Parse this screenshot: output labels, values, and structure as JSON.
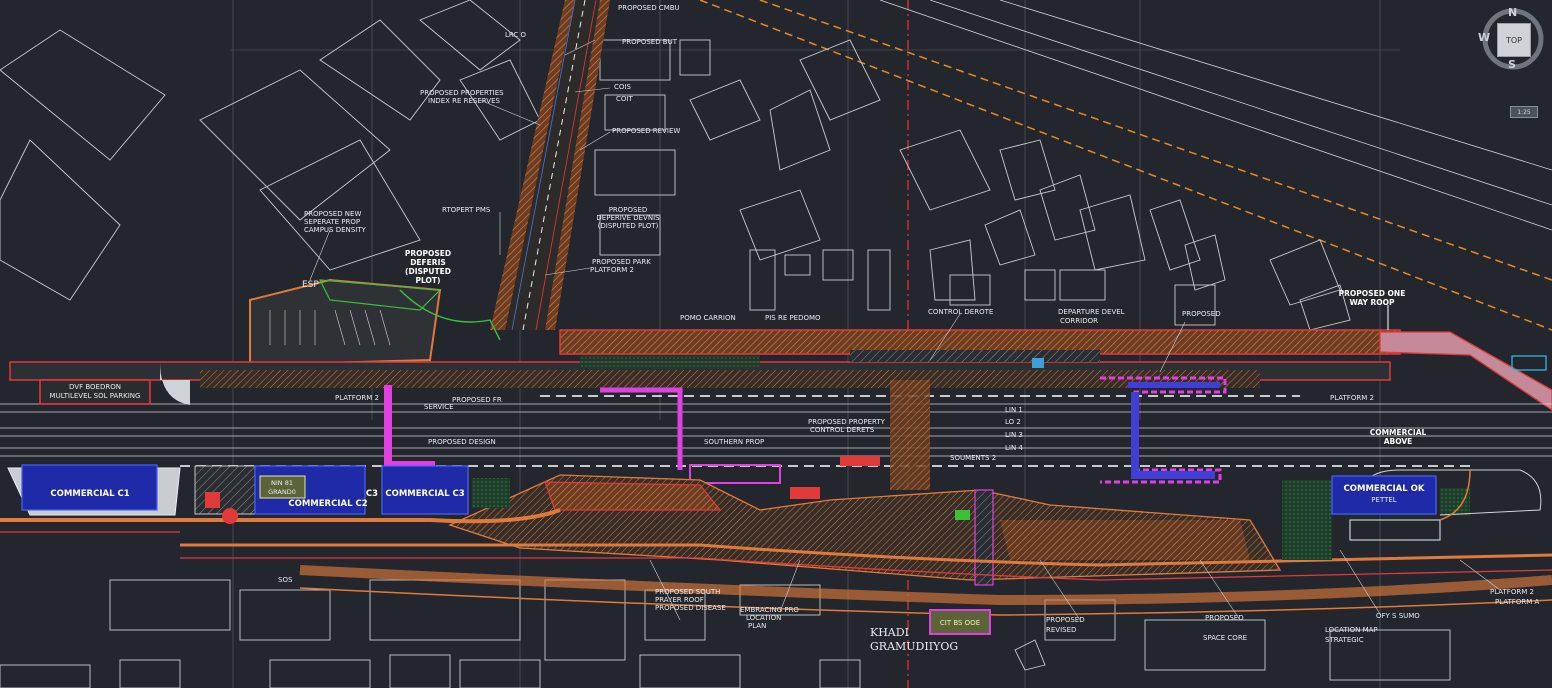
{
  "viewcube": {
    "top_label": "TOP",
    "north": "N",
    "west": "W",
    "south": "S",
    "scale_label": "1:25"
  },
  "labels": {
    "dvf_parking_1": "DVF BOEDRON",
    "dvf_parking_2": "MULTILEVEL SOL PARKING",
    "commercial_c1": "COMMERCIAL C1",
    "commercial_c2": "COMMERCIAL C2",
    "commercial_c3": "COMMERCIAL C3",
    "commercial_ok": "COMMERCIAL OK",
    "commercial_ok_sub": "PETTEL",
    "c3_label": "C3",
    "nin_grand_1": "NIN 81",
    "nin_grand_2": "GRAND0",
    "commercial_above_1": "COMMERCIAL",
    "commercial_above_2": "ABOVE",
    "proposed_fob_1": "PROPOSED ONE",
    "proposed_fob_2": "WAY ROOP",
    "platform_1": "PLATFORM 2",
    "platform_2": "PLATFORM 2",
    "proposed_disputed_1": "PROPOSED",
    "proposed_disputed_2": "DEFERIS",
    "proposed_disputed_3": "(DISPUTED",
    "proposed_disputed_4": "PLOT)",
    "disputed_plot_1": "PROPOSED",
    "disputed_plot_2": "DEPERIVE DEVNIS",
    "disputed_plot_3": "(DISPUTED PLOT)",
    "esp": "ESP",
    "sos": "SOS",
    "cit_badge": "CIT BS OOE",
    "khadi_1": "KHADI",
    "khadi_2": "GRAMUDIIYOG",
    "city_sewage": "OFY S SUMO",
    "road_a": "LRC O",
    "note_1": "PROPOSED PROPERTIES",
    "note_2": "INDEX RE RESERVES",
    "note_3": "COIS",
    "note_4": "COIT",
    "note_5": "PROPOSED REVIEW",
    "note_6": "PROPOSED CMBU",
    "note_7": "PROPOSED BUT",
    "note_8": "RTOPERT PMS",
    "note_9": "PROPOSED NEW",
    "note_10": "SEPERATE PROP",
    "note_11": "CAMPUS DENSITY",
    "note_12": "PROPOSED PARK",
    "note_13": "PLATFORM 2",
    "note_14": "POMO CARRION",
    "note_15": "PIS RE PEDOMO",
    "note_16": "CONTROL DEROTE",
    "note_17": "LIN 1",
    "note_18": "LO 2",
    "note_19": "LIN 3",
    "note_20": "LIN 4",
    "note_21": "SOUMENTS 2",
    "note_22": "DEPARTURE DEVEL",
    "note_23": "CORRIDOR",
    "note_24": "PROPOSED PROPERTY",
    "note_25": "CONTROL DERETS",
    "note_26": "PROPOSED",
    "note_27": "SOUTHERN PROP",
    "note_28": "PROPOSED DESIGN",
    "note_29": "SERVICE",
    "note_30": "PROPOSED FR",
    "note_31": "PROPOSED SOUTH",
    "note_32": "PRAYER ROOF",
    "note_33": "PROPOSED DISEASE",
    "note_34": "EMBRACING PRO",
    "note_35": "LOCATION",
    "note_36": "PLAN",
    "note_37": "PROPOSED",
    "note_38": "REVISED",
    "note_39": "PROPOSED",
    "note_40": "SPACE CORE",
    "note_41": "PLATFORM 2",
    "note_42": "PLATFORM A",
    "note_43": "LOCATION MAP",
    "note_44": "STRATEGIC"
  }
}
